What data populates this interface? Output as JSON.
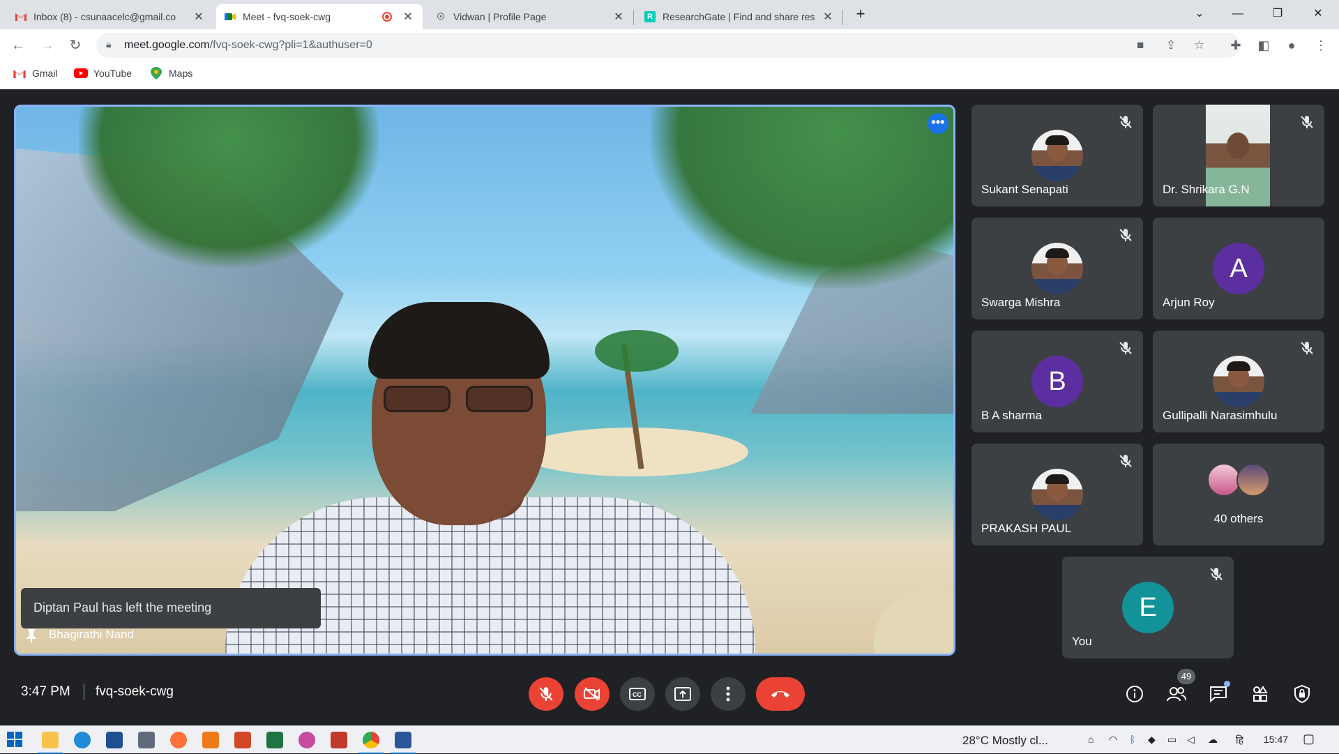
{
  "browser": {
    "tabs": [
      {
        "title": "Inbox (8) - csunaacelc@gmail.co",
        "favicon": "gmail-icon",
        "active": false
      },
      {
        "title": "Meet - fvq-soek-cwg",
        "favicon": "meet-icon",
        "active": true,
        "recording": true
      },
      {
        "title": "Vidwan | Profile Page",
        "favicon": "vidwan-icon",
        "active": false
      },
      {
        "title": "ResearchGate | Find and share res",
        "favicon": "researchgate-icon",
        "active": false
      }
    ],
    "url_host": "meet.google.com",
    "url_path": "/fvq-soek-cwg?pli=1&authuser=0",
    "bookmarks": [
      {
        "label": "Gmail",
        "icon": "gmail-icon"
      },
      {
        "label": "YouTube",
        "icon": "youtube-icon"
      },
      {
        "label": "Maps",
        "icon": "maps-icon"
      }
    ]
  },
  "meet": {
    "main_speaker": "Bhagirathi Nand",
    "toast": "Diptan Paul has left the meeting",
    "participants": [
      {
        "name": "Sukant Senapati",
        "kind": "photo",
        "muted": true
      },
      {
        "name": "Dr. Shrikara G.N",
        "kind": "video",
        "muted": true
      },
      {
        "name": "Swarga Mishra",
        "kind": "photo",
        "muted": true
      },
      {
        "name": "Arjun Roy",
        "kind": "letter",
        "letter": "A",
        "color": "#5b2fa0",
        "muted": false
      },
      {
        "name": "B A sharma",
        "kind": "letter",
        "letter": "B",
        "color": "#5b2fa0",
        "muted": true
      },
      {
        "name": "Gullipalli Narasimhulu",
        "kind": "photo",
        "muted": true
      },
      {
        "name": "PRAKASH PAUL",
        "kind": "photo",
        "muted": true
      },
      {
        "name": "40 others",
        "kind": "others",
        "muted": false
      }
    ],
    "self": {
      "name": "You",
      "letter": "E",
      "color": "#12939a",
      "muted": true
    },
    "time": "3:47 PM",
    "meeting_code": "fvq-soek-cwg",
    "people_count": "49"
  },
  "taskbar": {
    "weather": "28°C  Mostly cl...",
    "time": "15:47"
  },
  "colors": {
    "meet_bg": "#202124",
    "tile_bg": "#3c4043",
    "danger": "#ea4335",
    "accent": "#8ab4f8"
  }
}
